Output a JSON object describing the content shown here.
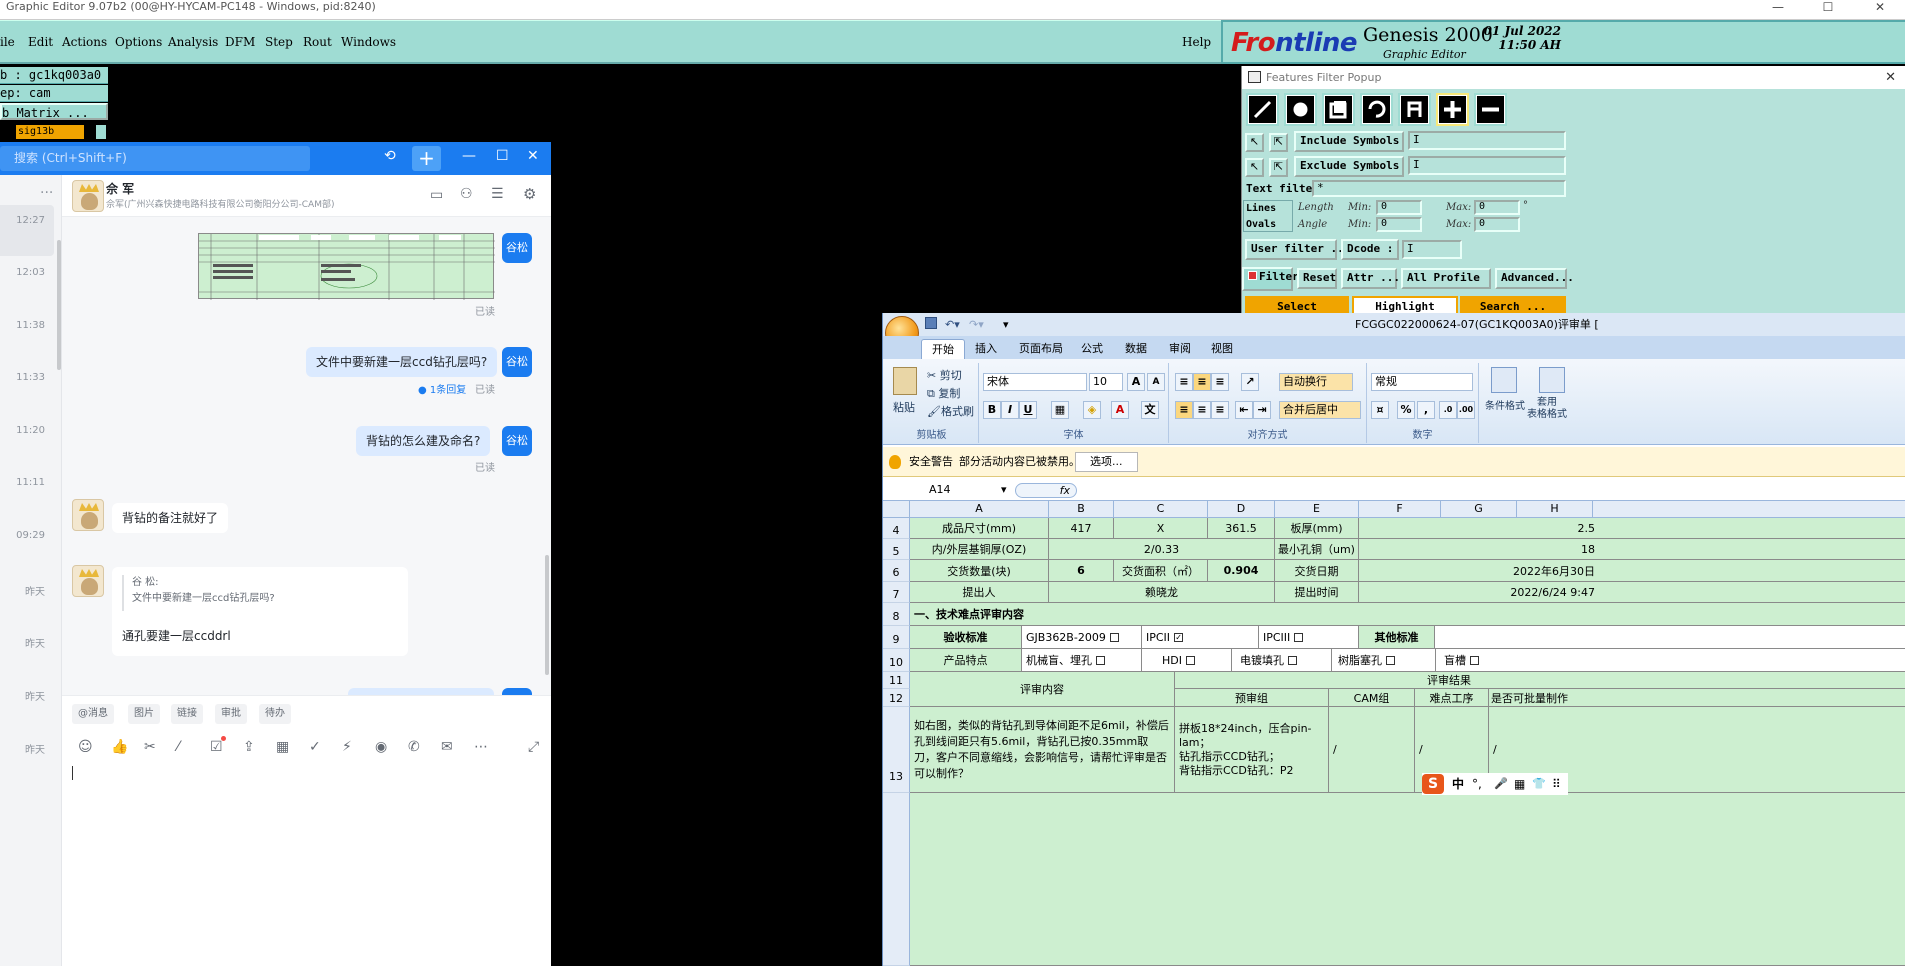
{
  "genesis": {
    "title": "Graphic Editor 9.07b2 (00@HY-HYCAM-PC148 - Windows, pid:8240)",
    "window_controls": [
      "—",
      "☐",
      "✕"
    ],
    "menu": [
      "ile",
      "Edit",
      "Actions",
      "Options",
      "Analysis",
      "DFM",
      "Step",
      "Rout",
      "Windows"
    ],
    "help": "Help",
    "logo": {
      "brand_prefix": "Fr",
      "brand_accent": "o",
      "brand_suffix": "ntline",
      "product": "Genesis 2000",
      "subtitle": "Graphic Editor",
      "date": "01 Jul 2022",
      "time": "11:50 AH"
    },
    "left_panel": {
      "job": "b : gc1kq003a0",
      "step": "ep: cam",
      "matrix": "b Matrix ...",
      "layer": "sig13b"
    }
  },
  "features_filter": {
    "title": "Features Filter Popup",
    "close": "✕",
    "include_symbols": "Include Symbols :",
    "exclude_symbols": "Exclude Symbols :",
    "include_value": "I",
    "exclude_value": "I",
    "text_filter": "Text filter",
    "text_filter_value": "*",
    "lines": "Lines",
    "ovals": "Ovals",
    "length": "Length",
    "angle": "Angle",
    "min": "Min:",
    "max": "Max:",
    "min_len": "0",
    "max_len": "0",
    "min_ang": "0",
    "max_ang": "0",
    "degree": "°",
    "user_filter": "User filter ...",
    "dcode": "Dcode :",
    "dcode_value": "I",
    "filter": "Filter",
    "reset": "Reset",
    "attr": "Attr ...",
    "all_profile": "All Profile",
    "advanced": "Advanced...",
    "select": "Select",
    "highlight": "Highlight",
    "search": "Search ..."
  },
  "chat": {
    "search_placeholder": "搜索 (Ctrl+Shift+F)",
    "top_icons": [
      "history-icon",
      "minimize-icon",
      "maximize-icon",
      "close-icon"
    ],
    "list_times": [
      "12:27",
      "12:03",
      "11:38",
      "11:33",
      "11:20",
      "11:11",
      "09:29",
      "昨天",
      "昨天",
      "昨天",
      "昨天"
    ],
    "contact_name": "佘 军",
    "contact_org": "佘军(广州兴森快捷电路科技有限公司衡阳分公司-CAM部)",
    "me_avatar": "谷松",
    "messages": {
      "m2": "文件中要新建一层ccd钻孔层吗?",
      "reply_count": "1条回复",
      "m3": "背钻的怎么建及命名?",
      "read": "已读",
      "in1": "背钻的备注就好了",
      "quote_name": "谷 松:",
      "quote_text": "文件中要新建一层ccd钻孔层吗?",
      "in2": "通孔要建一层ccddrl"
    },
    "quick_tags": [
      "@消息",
      "图片",
      "链接",
      "审批",
      "待办"
    ]
  },
  "excel": {
    "doc_title": "FCGGC022000624-07(GC1KQ003A0)评审单 [",
    "tabs": [
      "开始",
      "插入",
      "页面布局",
      "公式",
      "数据",
      "审阅",
      "视图"
    ],
    "clipboard": {
      "paste": "粘贴",
      "cut": "剪切",
      "copy": "复制",
      "format": "格式刷",
      "caption": "剪贴板"
    },
    "font": {
      "name": "宋体",
      "size": "10",
      "caption": "字体",
      "bold": "B",
      "italic": "I",
      "underline": "U",
      "color_a": "A"
    },
    "align": {
      "wrap": "自动换行",
      "merge": "合并后居中",
      "caption": "对齐方式"
    },
    "number": {
      "format": "常规",
      "percent": "%",
      "comma": ",",
      "caption": "数字"
    },
    "styles": {
      "cond": "条件格式",
      "table": "套用\n表格格式"
    },
    "security": {
      "label": "安全警告",
      "text": "部分活动内容已被禁用。",
      "options": "选项..."
    },
    "name_box": "A14",
    "fx": "fx",
    "columns": [
      "A",
      "B",
      "C",
      "D",
      "E",
      "F",
      "G",
      "H"
    ],
    "rows": {
      "r4": {
        "num": "4",
        "a": "成品尺寸(mm)",
        "b": "417",
        "c": "X",
        "d": "361.5",
        "e": "板厚(mm)",
        "h": "2.5"
      },
      "r5": {
        "num": "5",
        "a": "内/外层基铜厚(OZ)",
        "bcd": "2/0.33",
        "e": "最小孔铜（um)",
        "h": "18"
      },
      "r6": {
        "num": "6",
        "a": "交货数量(块)",
        "b": "6",
        "c": "交货面积（㎡）",
        "d": "0.904",
        "e": "交货日期",
        "h": "2022年6月30日"
      },
      "r7": {
        "num": "7",
        "a": "提出人",
        "bcd": "赖晓龙",
        "e": "提出时间",
        "h": "2022/6/24 9:47"
      },
      "r8": {
        "num": "8",
        "a": "一、技术难点评审内容"
      },
      "r9": {
        "num": "9",
        "a": "验收标准",
        "b": "GJB362B-2009",
        "d": "IPCII",
        "e": "IPCIII",
        "f": "其他标准"
      },
      "r10": {
        "num": "10",
        "a": "产品特点",
        "b": "机械盲、埋孔",
        "d": "HDI",
        "e": "电镀填孔",
        "f": "树脂塞孔",
        "g": "盲槽"
      },
      "r11": {
        "num": "11",
        "result": "评审结果"
      },
      "r12": {
        "num": "12",
        "a": "评审内容",
        "d": "预审组",
        "f": "CAM组",
        "g": "难点工序",
        "h": "是否可批量制作"
      },
      "r13": {
        "num": "13",
        "a": "如右图，类似的背钻孔到导体间距不足6mil，补偿后孔到线间距只有5.6mil，背钻孔已按0.35mm取刀，客户不同意缩线，会影响信号，请帮忙评审是否可以制作？",
        "d": "拼板18*24inch，压合pin-lam；\n钻孔指示CCD钻孔；\n背钻指示CCD钻孔：P2",
        "f": "/",
        "g": "/",
        "h": "/"
      }
    }
  },
  "ime": {
    "logo": "S",
    "lang": "中",
    "punct": "°,",
    "mic": "🎤",
    "kb": "▦",
    "shirt": "👕",
    "grid": "⠿"
  },
  "colors": {
    "genesis_teal": "#9fdcd3",
    "chat_blue": "#1b7cf0",
    "excel_green": "#cdefd0"
  }
}
